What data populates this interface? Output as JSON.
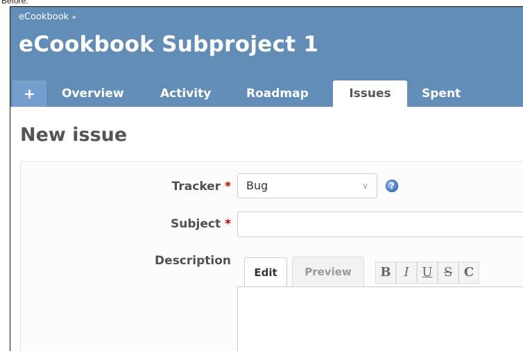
{
  "caption": "Before:",
  "header": {
    "breadcrumb": "eCookbook",
    "breadcrumb_sep": "»",
    "project_title": "eCookbook Subproject 1"
  },
  "tabs": [
    {
      "label": "+"
    },
    {
      "label": "Overview"
    },
    {
      "label": "Activity"
    },
    {
      "label": "Roadmap"
    },
    {
      "label": "Issues",
      "selected": true
    },
    {
      "label": "Spent time"
    }
  ],
  "page": {
    "title": "New issue"
  },
  "form": {
    "tracker_label": "Tracker",
    "tracker_value": "Bug",
    "required_mark": "*",
    "subject_label": "Subject",
    "subject_value": "",
    "description_label": "Description",
    "editor_tabs": {
      "edit": "Edit",
      "preview": "Preview"
    },
    "toolbar": [
      "B",
      "I",
      "U",
      "S",
      "C"
    ]
  },
  "icons": {
    "tracker_help": "help-icon",
    "select_chevron": "chevron-down-icon"
  },
  "colors": {
    "header_bg": "#628DB6",
    "plus_tab_bg": "#759FCF",
    "required": "#bb0000"
  }
}
